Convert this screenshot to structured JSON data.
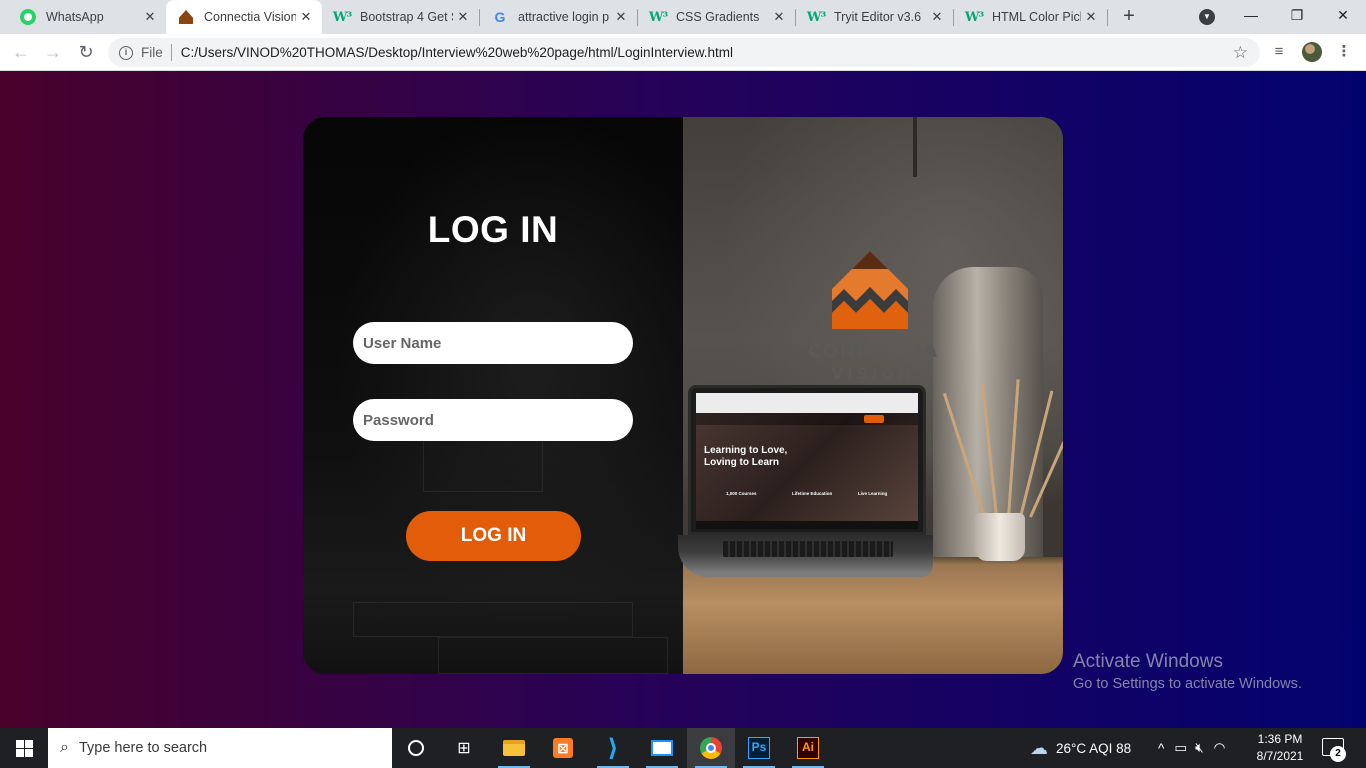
{
  "browser": {
    "tabs": [
      {
        "label": "WhatsApp",
        "icon": "whatsapp-icon",
        "active": false
      },
      {
        "label": "Connectia Vision",
        "icon": "connectia-favicon-icon",
        "active": true
      },
      {
        "label": "Bootstrap 4 Get S",
        "icon": "w3schools-icon",
        "active": false
      },
      {
        "label": "attractive login p",
        "icon": "google-icon",
        "active": false
      },
      {
        "label": "CSS Gradients",
        "icon": "w3schools-icon",
        "active": false
      },
      {
        "label": "Tryit Editor v3.6",
        "icon": "w3schools-icon",
        "active": false
      },
      {
        "label": "HTML Color Picke",
        "icon": "w3schools-icon",
        "active": false
      }
    ],
    "address": {
      "scheme_label": "File",
      "url": "C:/Users/VINOD%20THOMAS/Desktop/Interview%20web%20page/html/LoginInterview.html"
    }
  },
  "login": {
    "title": "LOG IN",
    "username_placeholder": "User Name",
    "password_placeholder": "Password",
    "button_label": "LOG IN"
  },
  "hero": {
    "brand": "CONNECTIA",
    "brand_sub": "VISION",
    "screen_headline_1": "Learning to Love,",
    "screen_headline_2": "Loving to Learn",
    "screen_features": [
      "1,000 Courses",
      "Lifetime Education",
      "Live Learning"
    ]
  },
  "watermark": {
    "line1": "Activate Windows",
    "line2": "Go to Settings to activate Windows."
  },
  "taskbar": {
    "search_placeholder": "Type here to search",
    "weather": "26°C  AQI 88",
    "time": "1:36 PM",
    "date": "8/7/2021",
    "notification_count": "2"
  },
  "colors": {
    "accent_button": "#e35c0a",
    "bg_gradient_left": "#49022b",
    "bg_gradient_right": "#02026e"
  }
}
